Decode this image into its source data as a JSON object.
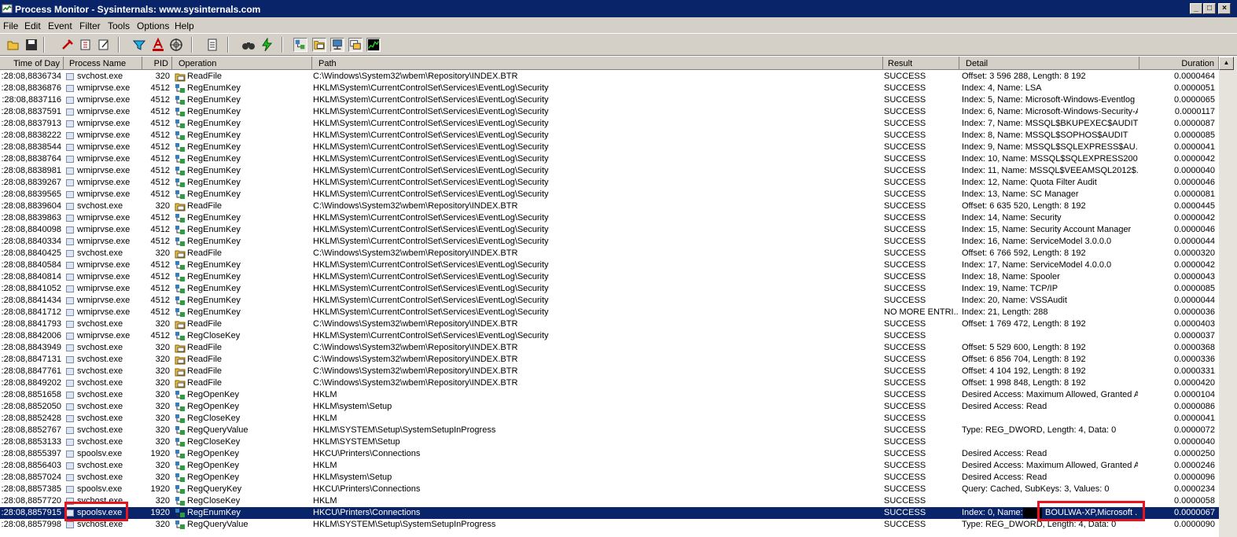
{
  "window": {
    "title": "Process Monitor - Sysinternals: www.sysinternals.com",
    "buttons": {
      "minimize": "_",
      "maximize": "□",
      "close": "×"
    }
  },
  "menu": [
    "File",
    "Edit",
    "Event",
    "Filter",
    "Tools",
    "Options",
    "Help"
  ],
  "toolbar": {
    "icons": [
      "open-icon",
      "save-icon",
      "capture-icon",
      "autoscroll-icon",
      "clear-icon",
      "filter-icon",
      "highlight-icon",
      "target-icon",
      "properties-icon",
      "find-icon",
      "jump-icon",
      "registry-activity-icon",
      "file-activity-icon",
      "network-activity-icon",
      "process-activity-icon",
      "profiling-icon"
    ]
  },
  "columns": {
    "time": "Time of Day",
    "process": "Process Name",
    "pid": "PID",
    "operation": "Operation",
    "path": "Path",
    "result": "Result",
    "detail": "Detail",
    "duration": "Duration"
  },
  "rows": [
    {
      "time": ":28:08,8836734",
      "proc": "svchost.exe",
      "pid": "320",
      "op": "ReadFile",
      "path": "C:\\Windows\\System32\\wbem\\Repository\\INDEX.BTR",
      "result": "SUCCESS",
      "detail": "Offset: 3 596 288, Length: 8 192",
      "dur": "0.0000464"
    },
    {
      "time": ":28:08,8836876",
      "proc": "wmiprvse.exe",
      "pid": "4512",
      "op": "RegEnumKey",
      "path": "HKLM\\System\\CurrentControlSet\\Services\\EventLog\\Security",
      "result": "SUCCESS",
      "detail": "Index: 4, Name: LSA",
      "dur": "0.0000051"
    },
    {
      "time": ":28:08,8837116",
      "proc": "wmiprvse.exe",
      "pid": "4512",
      "op": "RegEnumKey",
      "path": "HKLM\\System\\CurrentControlSet\\Services\\EventLog\\Security",
      "result": "SUCCESS",
      "detail": "Index: 5, Name: Microsoft-Windows-Eventlog",
      "dur": "0.0000065"
    },
    {
      "time": ":28:08,8837591",
      "proc": "wmiprvse.exe",
      "pid": "4512",
      "op": "RegEnumKey",
      "path": "HKLM\\System\\CurrentControlSet\\Services\\EventLog\\Security",
      "result": "SUCCESS",
      "detail": "Index: 6, Name: Microsoft-Windows-Security-A...",
      "dur": "0.0000117"
    },
    {
      "time": ":28:08,8837913",
      "proc": "wmiprvse.exe",
      "pid": "4512",
      "op": "RegEnumKey",
      "path": "HKLM\\System\\CurrentControlSet\\Services\\EventLog\\Security",
      "result": "SUCCESS",
      "detail": "Index: 7, Name: MSSQL$BKUPEXEC$AUDIT",
      "dur": "0.0000087"
    },
    {
      "time": ":28:08,8838222",
      "proc": "wmiprvse.exe",
      "pid": "4512",
      "op": "RegEnumKey",
      "path": "HKLM\\System\\CurrentControlSet\\Services\\EventLog\\Security",
      "result": "SUCCESS",
      "detail": "Index: 8, Name: MSSQL$SOPHOS$AUDIT",
      "dur": "0.0000085"
    },
    {
      "time": ":28:08,8838544",
      "proc": "wmiprvse.exe",
      "pid": "4512",
      "op": "RegEnumKey",
      "path": "HKLM\\System\\CurrentControlSet\\Services\\EventLog\\Security",
      "result": "SUCCESS",
      "detail": "Index: 9, Name: MSSQL$SQLEXPRESS$AU...",
      "dur": "0.0000041"
    },
    {
      "time": ":28:08,8838764",
      "proc": "wmiprvse.exe",
      "pid": "4512",
      "op": "RegEnumKey",
      "path": "HKLM\\System\\CurrentControlSet\\Services\\EventLog\\Security",
      "result": "SUCCESS",
      "detail": "Index: 10, Name: MSSQL$SQLEXPRESS200...",
      "dur": "0.0000042"
    },
    {
      "time": ":28:08,8838981",
      "proc": "wmiprvse.exe",
      "pid": "4512",
      "op": "RegEnumKey",
      "path": "HKLM\\System\\CurrentControlSet\\Services\\EventLog\\Security",
      "result": "SUCCESS",
      "detail": "Index: 11, Name: MSSQL$VEEAMSQL2012$...",
      "dur": "0.0000040"
    },
    {
      "time": ":28:08,8839267",
      "proc": "wmiprvse.exe",
      "pid": "4512",
      "op": "RegEnumKey",
      "path": "HKLM\\System\\CurrentControlSet\\Services\\EventLog\\Security",
      "result": "SUCCESS",
      "detail": "Index: 12, Name: Quota Filter Audit",
      "dur": "0.0000046"
    },
    {
      "time": ":28:08,8839565",
      "proc": "wmiprvse.exe",
      "pid": "4512",
      "op": "RegEnumKey",
      "path": "HKLM\\System\\CurrentControlSet\\Services\\EventLog\\Security",
      "result": "SUCCESS",
      "detail": "Index: 13, Name: SC Manager",
      "dur": "0.0000081"
    },
    {
      "time": ":28:08,8839604",
      "proc": "svchost.exe",
      "pid": "320",
      "op": "ReadFile",
      "path": "C:\\Windows\\System32\\wbem\\Repository\\INDEX.BTR",
      "result": "SUCCESS",
      "detail": "Offset: 6 635 520, Length: 8 192",
      "dur": "0.0000445"
    },
    {
      "time": ":28:08,8839863",
      "proc": "wmiprvse.exe",
      "pid": "4512",
      "op": "RegEnumKey",
      "path": "HKLM\\System\\CurrentControlSet\\Services\\EventLog\\Security",
      "result": "SUCCESS",
      "detail": "Index: 14, Name: Security",
      "dur": "0.0000042"
    },
    {
      "time": ":28:08,8840098",
      "proc": "wmiprvse.exe",
      "pid": "4512",
      "op": "RegEnumKey",
      "path": "HKLM\\System\\CurrentControlSet\\Services\\EventLog\\Security",
      "result": "SUCCESS",
      "detail": "Index: 15, Name: Security Account Manager",
      "dur": "0.0000046"
    },
    {
      "time": ":28:08,8840334",
      "proc": "wmiprvse.exe",
      "pid": "4512",
      "op": "RegEnumKey",
      "path": "HKLM\\System\\CurrentControlSet\\Services\\EventLog\\Security",
      "result": "SUCCESS",
      "detail": "Index: 16, Name: ServiceModel 3.0.0.0",
      "dur": "0.0000044"
    },
    {
      "time": ":28:08,8840425",
      "proc": "svchost.exe",
      "pid": "320",
      "op": "ReadFile",
      "path": "C:\\Windows\\System32\\wbem\\Repository\\INDEX.BTR",
      "result": "SUCCESS",
      "detail": "Offset: 6 766 592, Length: 8 192",
      "dur": "0.0000320"
    },
    {
      "time": ":28:08,8840584",
      "proc": "wmiprvse.exe",
      "pid": "4512",
      "op": "RegEnumKey",
      "path": "HKLM\\System\\CurrentControlSet\\Services\\EventLog\\Security",
      "result": "SUCCESS",
      "detail": "Index: 17, Name: ServiceModel 4.0.0.0",
      "dur": "0.0000042"
    },
    {
      "time": ":28:08,8840814",
      "proc": "wmiprvse.exe",
      "pid": "4512",
      "op": "RegEnumKey",
      "path": "HKLM\\System\\CurrentControlSet\\Services\\EventLog\\Security",
      "result": "SUCCESS",
      "detail": "Index: 18, Name: Spooler",
      "dur": "0.0000043"
    },
    {
      "time": ":28:08,8841052",
      "proc": "wmiprvse.exe",
      "pid": "4512",
      "op": "RegEnumKey",
      "path": "HKLM\\System\\CurrentControlSet\\Services\\EventLog\\Security",
      "result": "SUCCESS",
      "detail": "Index: 19, Name: TCP/IP",
      "dur": "0.0000085"
    },
    {
      "time": ":28:08,8841434",
      "proc": "wmiprvse.exe",
      "pid": "4512",
      "op": "RegEnumKey",
      "path": "HKLM\\System\\CurrentControlSet\\Services\\EventLog\\Security",
      "result": "SUCCESS",
      "detail": "Index: 20, Name: VSSAudit",
      "dur": "0.0000044"
    },
    {
      "time": ":28:08,8841712",
      "proc": "wmiprvse.exe",
      "pid": "4512",
      "op": "RegEnumKey",
      "path": "HKLM\\System\\CurrentControlSet\\Services\\EventLog\\Security",
      "result": "NO MORE ENTRI...",
      "detail": "Index: 21, Length: 288",
      "dur": "0.0000036"
    },
    {
      "time": ":28:08,8841793",
      "proc": "svchost.exe",
      "pid": "320",
      "op": "ReadFile",
      "path": "C:\\Windows\\System32\\wbem\\Repository\\INDEX.BTR",
      "result": "SUCCESS",
      "detail": "Offset: 1 769 472, Length: 8 192",
      "dur": "0.0000403"
    },
    {
      "time": ":28:08,8842006",
      "proc": "wmiprvse.exe",
      "pid": "4512",
      "op": "RegCloseKey",
      "path": "HKLM\\System\\CurrentControlSet\\Services\\EventLog\\Security",
      "result": "SUCCESS",
      "detail": "",
      "dur": "0.0000037"
    },
    {
      "time": ":28:08,8843949",
      "proc": "svchost.exe",
      "pid": "320",
      "op": "ReadFile",
      "path": "C:\\Windows\\System32\\wbem\\Repository\\INDEX.BTR",
      "result": "SUCCESS",
      "detail": "Offset: 5 529 600, Length: 8 192",
      "dur": "0.0000368"
    },
    {
      "time": ":28:08,8847131",
      "proc": "svchost.exe",
      "pid": "320",
      "op": "ReadFile",
      "path": "C:\\Windows\\System32\\wbem\\Repository\\INDEX.BTR",
      "result": "SUCCESS",
      "detail": "Offset: 6 856 704, Length: 8 192",
      "dur": "0.0000336"
    },
    {
      "time": ":28:08,8847761",
      "proc": "svchost.exe",
      "pid": "320",
      "op": "ReadFile",
      "path": "C:\\Windows\\System32\\wbem\\Repository\\INDEX.BTR",
      "result": "SUCCESS",
      "detail": "Offset: 4 104 192, Length: 8 192",
      "dur": "0.0000331"
    },
    {
      "time": ":28:08,8849202",
      "proc": "svchost.exe",
      "pid": "320",
      "op": "ReadFile",
      "path": "C:\\Windows\\System32\\wbem\\Repository\\INDEX.BTR",
      "result": "SUCCESS",
      "detail": "Offset: 1 998 848, Length: 8 192",
      "dur": "0.0000420"
    },
    {
      "time": ":28:08,8851658",
      "proc": "svchost.exe",
      "pid": "320",
      "op": "RegOpenKey",
      "path": "HKLM",
      "result": "SUCCESS",
      "detail": "Desired Access: Maximum Allowed, Granted A...",
      "dur": "0.0000104"
    },
    {
      "time": ":28:08,8852050",
      "proc": "svchost.exe",
      "pid": "320",
      "op": "RegOpenKey",
      "path": "HKLM\\system\\Setup",
      "result": "SUCCESS",
      "detail": "Desired Access: Read",
      "dur": "0.0000086"
    },
    {
      "time": ":28:08,8852428",
      "proc": "svchost.exe",
      "pid": "320",
      "op": "RegCloseKey",
      "path": "HKLM",
      "result": "SUCCESS",
      "detail": "",
      "dur": "0.0000041"
    },
    {
      "time": ":28:08,8852767",
      "proc": "svchost.exe",
      "pid": "320",
      "op": "RegQueryValue",
      "path": "HKLM\\SYSTEM\\Setup\\SystemSetupInProgress",
      "result": "SUCCESS",
      "detail": "Type: REG_DWORD, Length: 4, Data: 0",
      "dur": "0.0000072"
    },
    {
      "time": ":28:08,8853133",
      "proc": "svchost.exe",
      "pid": "320",
      "op": "RegCloseKey",
      "path": "HKLM\\SYSTEM\\Setup",
      "result": "SUCCESS",
      "detail": "",
      "dur": "0.0000040"
    },
    {
      "time": ":28:08,8855397",
      "proc": "spoolsv.exe",
      "pid": "1920",
      "op": "RegOpenKey",
      "path": "HKCU\\Printers\\Connections",
      "result": "SUCCESS",
      "detail": "Desired Access: Read",
      "dur": "0.0000250"
    },
    {
      "time": ":28:08,8856403",
      "proc": "svchost.exe",
      "pid": "320",
      "op": "RegOpenKey",
      "path": "HKLM",
      "result": "SUCCESS",
      "detail": "Desired Access: Maximum Allowed, Granted A...",
      "dur": "0.0000246"
    },
    {
      "time": ":28:08,8857024",
      "proc": "svchost.exe",
      "pid": "320",
      "op": "RegOpenKey",
      "path": "HKLM\\system\\Setup",
      "result": "SUCCESS",
      "detail": "Desired Access: Read",
      "dur": "0.0000096"
    },
    {
      "time": ":28:08,8857385",
      "proc": "spoolsv.exe",
      "pid": "1920",
      "op": "RegQueryKey",
      "path": "HKCU\\Printers\\Connections",
      "result": "SUCCESS",
      "detail": "Query: Cached, SubKeys: 3, Values: 0",
      "dur": "0.0000234"
    },
    {
      "time": ":28:08,8857720",
      "proc": "svchost.exe",
      "pid": "320",
      "op": "RegCloseKey",
      "path": "HKLM",
      "result": "SUCCESS",
      "detail": "",
      "dur": "0.0000058"
    },
    {
      "time": ":28:08,8857915",
      "proc": "spoolsv.exe",
      "pid": "1920",
      "op": "RegEnumKey",
      "path": "HKCU\\Printers\\Connections",
      "result": "SUCCESS",
      "detail": "Index: 0, Name:",
      "detail_extra": "BOULWA-XP,Microsoft ...",
      "dur": "0.0000067",
      "selected": true
    },
    {
      "time": ":28:08,8857998",
      "proc": "svchost.exe",
      "pid": "320",
      "op": "RegQueryValue",
      "path": "HKLM\\SYSTEM\\Setup\\SystemSetupInProgress",
      "result": "SUCCESS",
      "detail": "Type: REG_DWORD, Length: 4, Data: 0",
      "dur": "0.0000090"
    }
  ]
}
